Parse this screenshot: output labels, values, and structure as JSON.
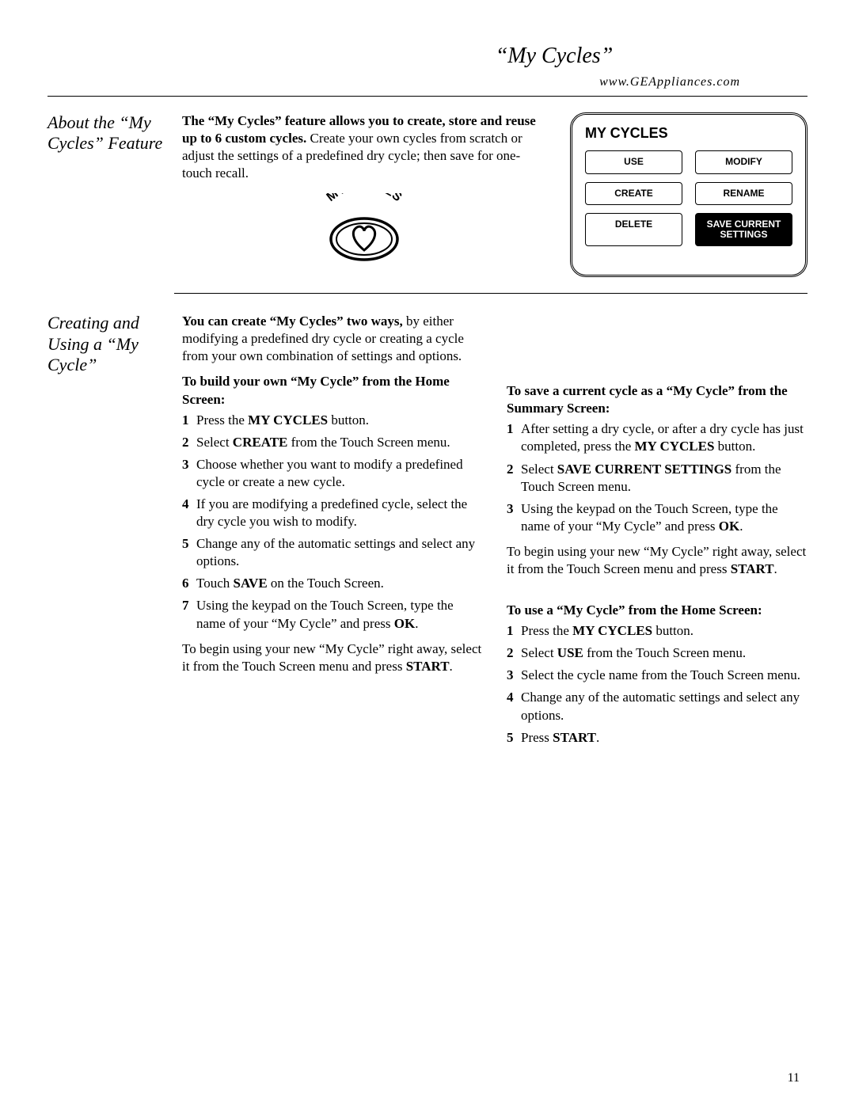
{
  "header": {
    "title": "“My Cycles”",
    "url": "www.GEAppliances.com"
  },
  "section1": {
    "heading": "About the “My Cycles” Feature",
    "intro_bold": "The “My Cycles” feature allows you to create, store and reuse up to 6 custom cycles.",
    "intro_rest": " Create your own cycles from scratch or adjust the settings of a predefined dry cycle; then save for one-touch recall.",
    "icon_label": "MY CYCLES",
    "panel": {
      "title": "MY CYCLES",
      "buttons": {
        "use": "USE",
        "modify": "MODIFY",
        "create": "CREATE",
        "rename": "RENAME",
        "delete": "DELETE",
        "save": "SAVE CURRENT SETTINGS"
      }
    }
  },
  "section2": {
    "heading": "Creating and Using a “My Cycle”",
    "left": {
      "intro_bold": "You can create “My Cycles” two ways,",
      "intro_rest": " by either modifying a predefined dry cycle or creating a cycle from your own combination of settings and options.",
      "subhead": "To build your own “My Cycle” from the Home Screen:",
      "steps": {
        "s1a": "Press the ",
        "s1b": "MY CYCLES",
        "s1c": " button.",
        "s2a": "Select ",
        "s2b": "CREATE",
        "s2c": " from the Touch Screen menu.",
        "s3": "Choose whether you want to modify a predefined cycle or create a new cycle.",
        "s4": "If you are modifying a predefined cycle, select the dry cycle you wish to modify.",
        "s5": "Change any of the automatic settings and select any options.",
        "s6a": "Touch ",
        "s6b": "SAVE",
        "s6c": " on the Touch Screen.",
        "s7a": "Using the keypad on the Touch Screen, type the name of your “My Cycle” and press ",
        "s7b": "OK",
        "s7c": "."
      },
      "after_a": "To begin using your new “My Cycle” right away, select it from the Touch Screen menu and press ",
      "after_b": "START",
      "after_c": "."
    },
    "right": {
      "subhead1": "To save a current cycle as a “My Cycle” from the Summary Screen:",
      "steps1": {
        "s1a": "After setting a dry cycle, or after a dry cycle has just completed, press the ",
        "s1b": "MY CYCLES",
        "s1c": " button.",
        "s2a": "Select ",
        "s2b": "SAVE CURRENT SETTINGS",
        "s2c": " from the Touch Screen menu.",
        "s3a": "Using the keypad on the Touch Screen, type the name of your “My Cycle” and press ",
        "s3b": "OK",
        "s3c": "."
      },
      "after1_a": "To begin using your new “My Cycle” right away, select it from the Touch Screen menu and press ",
      "after1_b": "START",
      "after1_c": ".",
      "subhead2": "To use a “My Cycle” from the Home Screen:",
      "steps2": {
        "s1a": "Press the ",
        "s1b": "MY CYCLES",
        "s1c": " button.",
        "s2a": "Select ",
        "s2b": "USE",
        "s2c": " from the Touch Screen menu.",
        "s3": "Select the cycle name from the Touch Screen menu.",
        "s4": "Change any of the automatic settings and select any options.",
        "s5a": "Press ",
        "s5b": "START",
        "s5c": "."
      }
    }
  },
  "page_number": "11"
}
